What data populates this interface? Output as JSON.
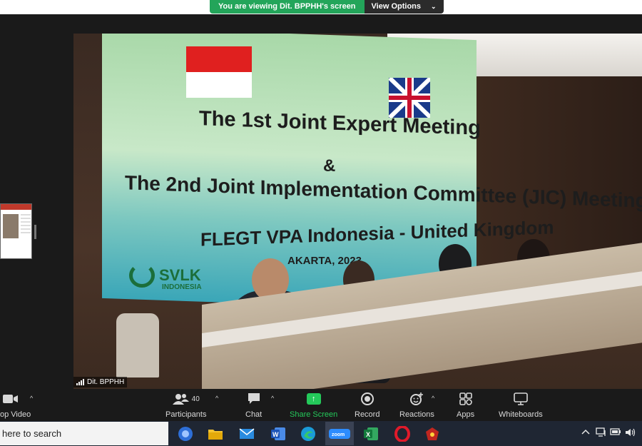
{
  "banner": {
    "viewing_text": "You are viewing Dit. BPPHH's screen",
    "view_options_label": "View Options"
  },
  "video": {
    "speaker_name": "Dit. BPPHH",
    "backdrop": {
      "line1": "The 1st Joint Expert Meeting",
      "line2": "&",
      "line3": "The 2nd Joint Implementation Committee (JIC) Meeting",
      "line4": "FLEGT VPA Indonesia - United Kingdom",
      "line5": "AKARTA, 2023",
      "logo_name": "SVLK",
      "logo_sub": "INDONESIA"
    }
  },
  "toolbar": {
    "items": [
      {
        "label": "op Video",
        "icon": "video-camera-icon"
      },
      {
        "label": "Participants",
        "icon": "participants-icon",
        "count": "40"
      },
      {
        "label": "Chat",
        "icon": "chat-icon"
      },
      {
        "label": "Share Screen",
        "icon": "share-screen-icon"
      },
      {
        "label": "Record",
        "icon": "record-icon"
      },
      {
        "label": "Reactions",
        "icon": "reactions-icon"
      },
      {
        "label": "Apps",
        "icon": "apps-icon"
      },
      {
        "label": "Whiteboards",
        "icon": "whiteboards-icon"
      }
    ]
  },
  "taskbar": {
    "search_text": "here to search",
    "apps": [
      "windows-icon",
      "file-explorer-icon",
      "mail-icon",
      "word-icon",
      "edge-icon",
      "zoom-icon",
      "excel-icon",
      "opera-icon",
      "app-icon"
    ],
    "tray": [
      "chevron-up-icon",
      "network-icon",
      "battery-icon",
      "volume-icon"
    ]
  },
  "colors": {
    "share_green": "#24c95a",
    "banner_green": "#23a55a",
    "toolbar_bg": "#1a1a1a",
    "taskbar_bg": "#1f2633"
  }
}
